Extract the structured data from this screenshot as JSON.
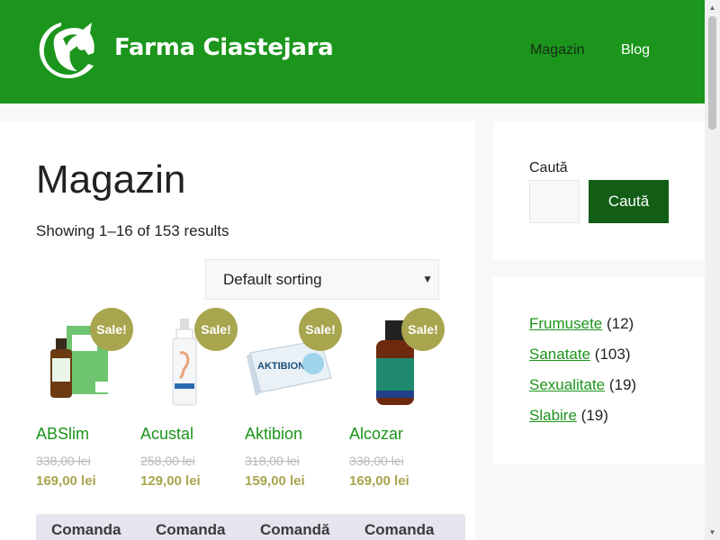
{
  "header": {
    "site_title": "Farma Ciastejara",
    "nav": [
      {
        "label": "Magazin"
      },
      {
        "label": "Blog"
      }
    ],
    "colors": {
      "header_bg": "#1b951b",
      "accent": "#125e17",
      "sale": "#a8a54e"
    }
  },
  "main": {
    "title": "Magazin",
    "result_count": "Showing 1–16 of 153 results",
    "sorting": {
      "selected": "Default sorting"
    },
    "products": [
      {
        "name": "ABSlim",
        "badge": "Sale!",
        "old_price": "338,00 lei",
        "new_price": "169,00 lei",
        "icon": "product-bottle-icon"
      },
      {
        "name": "Acustal",
        "badge": "Sale!",
        "old_price": "258,00 lei",
        "new_price": "129,00 lei",
        "icon": "product-spray-icon"
      },
      {
        "name": "Aktibion",
        "badge": "Sale!",
        "old_price": "318,00 lei",
        "new_price": "159,00 lei",
        "icon": "product-box-icon"
      },
      {
        "name": "Alcozar",
        "badge": "Sale!",
        "old_price": "338,00 lei",
        "new_price": "169,00 lei",
        "icon": "product-bottle-icon"
      }
    ],
    "order_labels": [
      "Comanda",
      "Comanda",
      "Comandă",
      "Comanda"
    ]
  },
  "sidebar": {
    "search": {
      "label": "Caută",
      "button": "Caută"
    },
    "categories": [
      {
        "name": "Frumusete",
        "count": "(12)"
      },
      {
        "name": "Sanatate",
        "count": "(103)"
      },
      {
        "name": "Sexualitate",
        "count": "(19)"
      },
      {
        "name": "Slabire",
        "count": "(19)"
      }
    ]
  }
}
